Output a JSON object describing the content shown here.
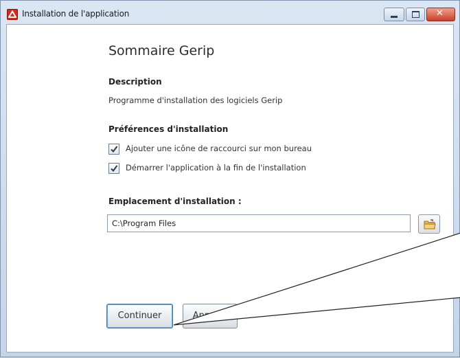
{
  "window": {
    "title": "Installation de l'application"
  },
  "summary": {
    "heading": "Sommaire Gerip",
    "description_label": "Description",
    "description_text": "Programme d'installation des logiciels Gerip",
    "preferences_label": "Préférences d'installation",
    "options": [
      {
        "label": "Ajouter une icône de raccourci sur mon bureau",
        "checked": true
      },
      {
        "label": "Démarrer l'application à la fin de l'installation",
        "checked": true
      }
    ],
    "location_label": "Emplacement d'installation :",
    "location_value": "C:\\Program Files"
  },
  "buttons": {
    "continue": "Continuer",
    "cancel": "Annuler"
  },
  "icons": {
    "app": "adobe-air-icon",
    "browse": "folder-icon",
    "minimize": "minimize-icon",
    "maximize": "maximize-icon",
    "close": "close-icon"
  }
}
